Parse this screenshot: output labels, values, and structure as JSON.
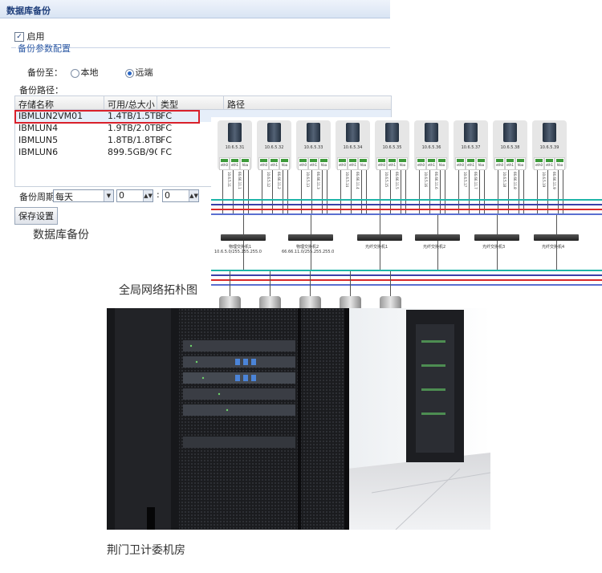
{
  "panel": {
    "title": "数据库备份",
    "enable_label": "启用",
    "enable_checked": true,
    "fieldset_legend": "备份参数配置",
    "target_label": "备份至：",
    "target_options": [
      "本地",
      "远端"
    ],
    "target_selected": "远端",
    "path_label": "备份路径：",
    "columns": [
      "存储名称",
      "可用/总大小",
      "类型",
      "路径"
    ],
    "rows": [
      {
        "name": "IBMLUN2VM01",
        "size": "1.4TB/1.5TB",
        "type": "FC",
        "path": ""
      },
      {
        "name": "IBMLUN4",
        "size": "1.9TB/2.0TB",
        "type": "FC",
        "path": ""
      },
      {
        "name": "IBMLUN5",
        "size": "1.8TB/1.8TB",
        "type": "FC",
        "path": ""
      },
      {
        "name": "IBMLUN6",
        "size": "899.5GB/90...",
        "type": "FC",
        "path": ""
      }
    ],
    "selected_row": 0,
    "period_label": "备份周期:",
    "period_value": "每天",
    "hour_value": "0",
    "minute_value": "0",
    "time_separator": ":",
    "save_label": "保存设置"
  },
  "captions": {
    "backup": "数据库备份",
    "topology": "全局网络拓朴图",
    "room": "荆门卫计委机房"
  },
  "topology": {
    "servers": [
      {
        "ip": "10.6.5.31",
        "hba": "10.6.5.11",
        "eth": "66.66.11.1"
      },
      {
        "ip": "10.6.5.32",
        "hba": "10.6.5.12",
        "eth": "66.66.11.2"
      },
      {
        "ip": "10.6.5.33",
        "hba": "10.6.5.13",
        "eth": "66.66.11.3"
      },
      {
        "ip": "10.6.5.34",
        "hba": "10.6.5.14",
        "eth": "66.66.11.4"
      },
      {
        "ip": "10.6.5.35",
        "hba": "10.6.5.15",
        "eth": "66.66.11.5"
      },
      {
        "ip": "10.6.5.36",
        "hba": "10.6.5.16",
        "eth": "66.66.11.6"
      },
      {
        "ip": "10.6.5.37",
        "hba": "10.6.5.17",
        "eth": "66.66.11.7"
      },
      {
        "ip": "10.6.5.38",
        "hba": "10.6.5.18",
        "eth": "66.66.11.8"
      },
      {
        "ip": "10.6.5.39",
        "hba": "10.6.5.19",
        "eth": "66.66.11.9"
      }
    ],
    "nic_labels": [
      "eth0",
      "eth1",
      "hba"
    ],
    "switches": [
      {
        "name": "物理交换机1",
        "subnet": "10.6.5.0/255.255.255.0"
      },
      {
        "name": "物理交换机2",
        "subnet": "66.66.11.0/255.255.255.0"
      },
      {
        "name": "光纤交换机1",
        "subnet": ""
      },
      {
        "name": "光纤交换机2",
        "subnet": ""
      },
      {
        "name": "光纤交换机3",
        "subnet": ""
      },
      {
        "name": "光纤交换机4",
        "subnet": ""
      }
    ],
    "line_colors": [
      "#1fb5a8",
      "#3a3fa8",
      "#d92a2a",
      "#5a6fd0"
    ],
    "storage_count": 5
  },
  "colors": {
    "accent": "#1d3d7a",
    "highlight": "#d9202b"
  },
  "icons": {
    "checkbox": "checkbox-checked-icon",
    "radio": "radio-icon",
    "server": "server-icon",
    "switch": "network-switch-icon",
    "disk": "storage-disk-icon"
  }
}
